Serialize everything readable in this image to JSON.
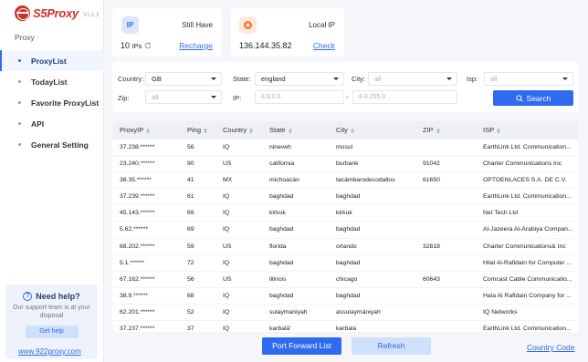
{
  "app": {
    "name": "S5Proxy",
    "version": "V1.0.3"
  },
  "sidebar": {
    "section": "Proxy",
    "items": [
      {
        "label": "ProxyList",
        "active": true
      },
      {
        "label": "TodayList",
        "active": false
      },
      {
        "label": "Favorite ProxyList",
        "active": false
      },
      {
        "label": "API",
        "active": false
      },
      {
        "label": "General Setting",
        "active": false
      }
    ],
    "help": {
      "title": "Need help?",
      "text": "Our support team is at your disposal",
      "button": "Get help",
      "link": "www.922proxy.com"
    }
  },
  "cards": {
    "ip": {
      "badge": "IP",
      "label": "Still Have",
      "count": "10",
      "unit": "IPs",
      "link": "Recharge"
    },
    "local": {
      "label": "Local IP",
      "value": "136.144.35.82",
      "link": "Check"
    }
  },
  "filters": {
    "country": {
      "label": "Country:",
      "value": "GB"
    },
    "state": {
      "label": "State:",
      "value": "england"
    },
    "city": {
      "label": "City:",
      "value": "all"
    },
    "isp": {
      "label": "Isp:",
      "value": "all"
    },
    "zip": {
      "label": "Zip:",
      "value": "all"
    },
    "ip": {
      "label": "IP:",
      "from": "8.8.0.0",
      "to": "8.8.255.0",
      "dash": "-"
    },
    "search_button": "Search"
  },
  "table": {
    "columns": [
      "ProxyIP",
      "Ping",
      "Country",
      "State",
      "City",
      "ZIP",
      "ISP"
    ],
    "rows": [
      [
        "37.238.******",
        "56",
        "IQ",
        "nineveh",
        "mosul",
        "",
        "EarthLink Ltd. Communication..."
      ],
      [
        "23.240.******",
        "90",
        "US",
        "california",
        "burbank",
        "91042",
        "Charter Communications Inc"
      ],
      [
        "38.35.******",
        "41",
        "MX",
        "michoacán",
        "tacámbarodecodallos",
        "61650",
        "OPTOENLACES S.A. DE C.V."
      ],
      [
        "37.239.******",
        "61",
        "IQ",
        "baghdad",
        "baghdad",
        "",
        "EarthLink Ltd. Communication..."
      ],
      [
        "45.143.******",
        "69",
        "IQ",
        "kirkuk",
        "kirkuk",
        "",
        "Net Tech Ltd"
      ],
      [
        "5.62.******",
        "69",
        "IQ",
        "baghdad",
        "baghdad",
        "",
        "Al-Jazeera Al-Arabiya Compan..."
      ],
      [
        "68.202.******",
        "59",
        "US",
        "florida",
        "orlando",
        "32818",
        "Charter Communications& Inc"
      ],
      [
        "5.1.******",
        "72",
        "IQ",
        "baghdad",
        "baghdad",
        "",
        "Hilal Al-Rafidain for Computer ..."
      ],
      [
        "67.162.******",
        "56",
        "US",
        "illinois",
        "chicago",
        "60643",
        "Comcast Cable Communicatio..."
      ],
      [
        "38.9.******",
        "68",
        "IQ",
        "baghdad",
        "baghdad",
        "",
        "Hala Al Rafidain Company for ..."
      ],
      [
        "62.201.******",
        "52",
        "IQ",
        "sulaymaniyah",
        "assulaymániyah",
        "",
        "IQ Networks"
      ],
      [
        "37.237.******",
        "37",
        "IQ",
        "karbalā'",
        "karbala",
        "",
        "EarthLink Ltd. Communication..."
      ]
    ]
  },
  "footer": {
    "port_forward": "Port Forward List",
    "refresh": "Refresh",
    "country_code": "Country Code"
  }
}
